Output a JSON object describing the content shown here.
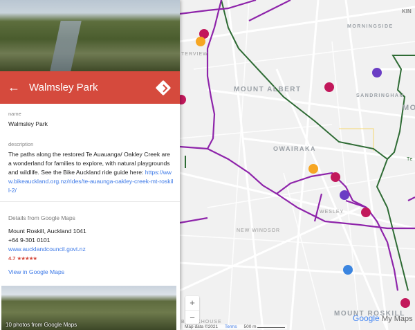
{
  "place": {
    "title": "Walmsley Park",
    "name_label": "name",
    "name": "Walmsley Park",
    "description_label": "description",
    "description": "The paths along the restored Te Auauanga/ Oakley Creek are a wonderland for families to explore, with natural playgrounds and wildlife. See the Bike Auckland ride guide here: ",
    "description_link": "https://www.bikeauckland.org.nz/rides/te-auaunga-oakley-creek-mt-roskill-2/"
  },
  "details": {
    "heading": "Details from Google Maps",
    "address": "Mount Roskill, Auckland 1041",
    "phone": "+64 9-301 0101",
    "website": "www.aucklandcouncil.govt.nz",
    "rating": "4.7",
    "stars": "★★★★★",
    "rating_value": 4.7,
    "view_link": "View in Google Maps",
    "photos_caption": "10 photos from Google Maps"
  },
  "icons": {
    "back": "arrow-back-icon",
    "directions": "directions-icon"
  },
  "colors": {
    "header": "#d54a3d",
    "purple_route": "#8e24aa",
    "green_route": "#2e6b34",
    "link": "#3b78e7"
  },
  "map": {
    "labels": [
      "MORNINGSIDE",
      "MOUNT ALBERT",
      "SANDRINGHAM",
      "OWAIRAKA",
      "WESLEY",
      "NEW WINDSOR",
      "MOUNT ROSKILL",
      "KIN",
      "MOU",
      "TERVIEW",
      "BLOCKHOUSE",
      "Te"
    ],
    "zoom_in": "+",
    "zoom_out": "−",
    "map_data": "Map data ©2021",
    "terms": "Terms",
    "scale": "500 m",
    "brand_google": "Google",
    "brand_mymaps": "My Maps"
  }
}
